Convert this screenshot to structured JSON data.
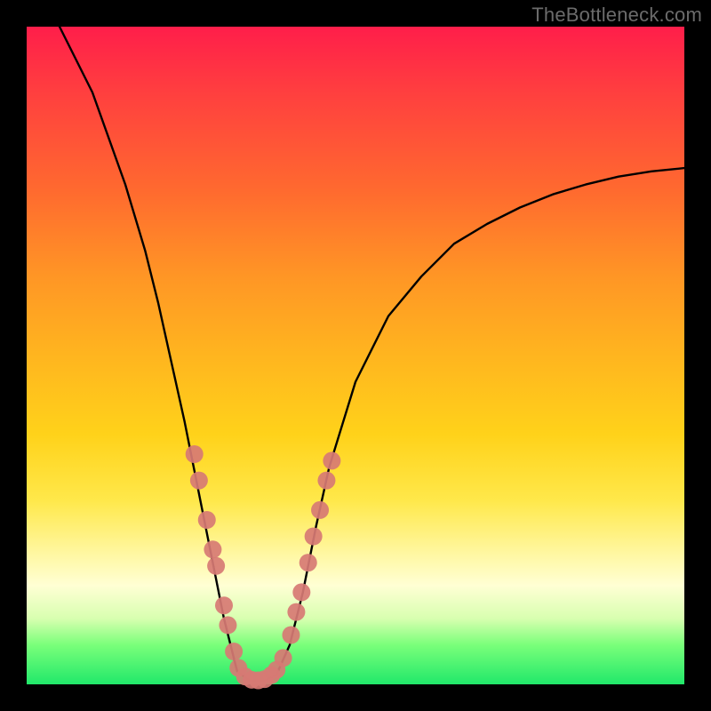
{
  "watermark": "TheBottleneck.com",
  "chart_data": {
    "type": "line",
    "title": "",
    "xlabel": "",
    "ylabel": "",
    "xlim": [
      0,
      100
    ],
    "ylim": [
      0,
      100
    ],
    "series": [
      {
        "name": "left-arm",
        "x": [
          5,
          10,
          15,
          18,
          20,
          22,
          24,
          26,
          28,
          30,
          32
        ],
        "values": [
          100,
          90,
          76,
          66,
          58,
          49,
          40,
          30,
          20,
          10,
          2
        ]
      },
      {
        "name": "valley-floor",
        "x": [
          32,
          34,
          36,
          38
        ],
        "values": [
          2,
          0.5,
          0.5,
          1.5
        ]
      },
      {
        "name": "right-arm",
        "x": [
          38,
          40,
          42,
          44,
          46,
          50,
          55,
          60,
          65,
          70,
          75,
          80,
          85,
          90,
          95,
          100
        ],
        "values": [
          1.5,
          6,
          14,
          24,
          33,
          46,
          56,
          62,
          67,
          70,
          72.5,
          74.5,
          76,
          77.2,
          78,
          78.5
        ]
      }
    ],
    "markers": {
      "name": "highlighted-points",
      "color_hex": "#d77a74",
      "points": [
        {
          "x": 25.5,
          "y": 35
        },
        {
          "x": 26.2,
          "y": 31
        },
        {
          "x": 27.4,
          "y": 25
        },
        {
          "x": 28.3,
          "y": 20.5
        },
        {
          "x": 28.8,
          "y": 18
        },
        {
          "x": 30.0,
          "y": 12
        },
        {
          "x": 30.6,
          "y": 9
        },
        {
          "x": 31.5,
          "y": 5
        },
        {
          "x": 32.2,
          "y": 2.5
        },
        {
          "x": 33.2,
          "y": 1.2
        },
        {
          "x": 34.2,
          "y": 0.7
        },
        {
          "x": 35.2,
          "y": 0.6
        },
        {
          "x": 36.2,
          "y": 0.8
        },
        {
          "x": 37.2,
          "y": 1.4
        },
        {
          "x": 38.0,
          "y": 2.2
        },
        {
          "x": 39.0,
          "y": 4.0
        },
        {
          "x": 40.2,
          "y": 7.5
        },
        {
          "x": 41.0,
          "y": 11
        },
        {
          "x": 41.8,
          "y": 14
        },
        {
          "x": 42.8,
          "y": 18.5
        },
        {
          "x": 43.6,
          "y": 22.5
        },
        {
          "x": 44.6,
          "y": 26.5
        },
        {
          "x": 45.6,
          "y": 31
        },
        {
          "x": 46.4,
          "y": 34
        }
      ]
    },
    "colors": {
      "curve": "#000000",
      "marker": "#d77a74",
      "gradient_top": "#ff1e4a",
      "gradient_bottom": "#21e86a",
      "frame": "#000000"
    }
  }
}
